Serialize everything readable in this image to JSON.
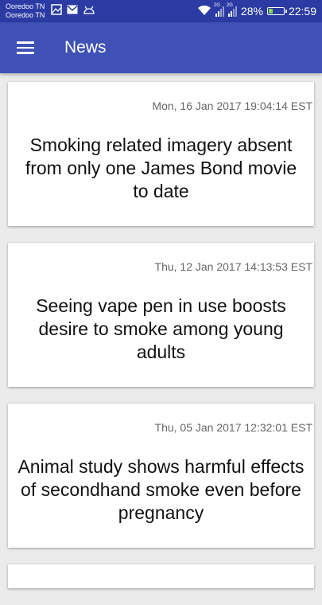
{
  "status_bar": {
    "carriers": [
      "Ooredoo TN",
      "Ooredoo TN"
    ],
    "network_labels": [
      "2G",
      "2G"
    ],
    "battery_percent": "28%",
    "time": "22:59",
    "icons": [
      "image-icon",
      "mail-icon",
      "android-icon",
      "wifi-icon",
      "signal-icon",
      "battery-charging-icon"
    ]
  },
  "app_bar": {
    "title": "News",
    "menu_icon": "hamburger-menu-icon",
    "color": "#3f51b5"
  },
  "news": [
    {
      "date": "Mon, 16 Jan 2017 19:04:14 EST",
      "headline": "Smoking related imagery absent from only one James Bond movie to date"
    },
    {
      "date": "Thu, 12 Jan 2017 14:13:53 EST",
      "headline": "Seeing vape pen in use boosts desire to smoke among young adults"
    },
    {
      "date": "Thu, 05 Jan 2017 12:32:01 EST",
      "headline": "Animal study shows harmful effects of secondhand smoke even before pregnancy"
    }
  ]
}
